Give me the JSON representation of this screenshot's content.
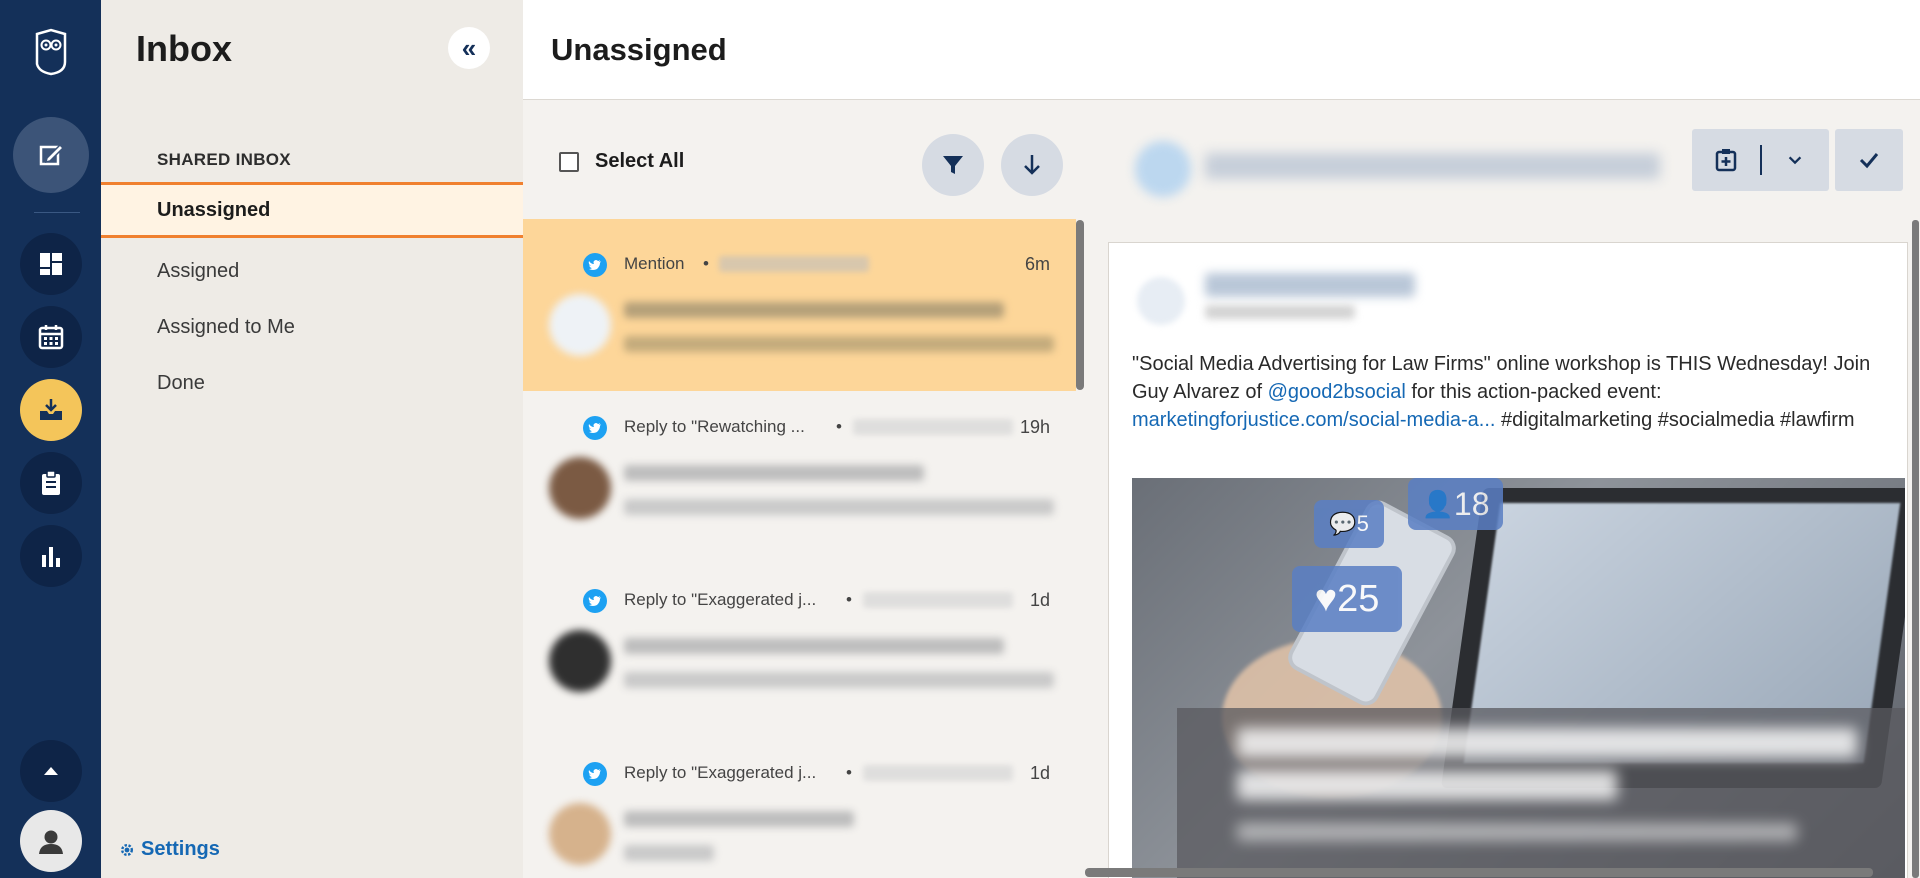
{
  "app": {
    "brand_icon": "owl-logo-icon"
  },
  "rail": {
    "items": [
      {
        "name": "compose",
        "icon": "compose-icon"
      },
      {
        "name": "dashboard",
        "icon": "dashboard-grid-icon"
      },
      {
        "name": "planner",
        "icon": "calendar-icon"
      },
      {
        "name": "inbox",
        "icon": "inbox-icon",
        "active": true
      },
      {
        "name": "assignments",
        "icon": "clipboard-icon"
      },
      {
        "name": "analytics",
        "icon": "bar-chart-icon"
      },
      {
        "name": "expand",
        "icon": "chevron-up-icon"
      },
      {
        "name": "profile",
        "icon": "user-avatar-icon"
      }
    ],
    "accent": "#f4c55a"
  },
  "nav": {
    "title": "Inbox",
    "section_label": "SHARED INBOX",
    "items": [
      {
        "label": "Unassigned",
        "active": true
      },
      {
        "label": "Assigned"
      },
      {
        "label": "Assigned to Me"
      },
      {
        "label": "Done"
      }
    ],
    "settings_label": "Settings"
  },
  "header": {
    "title": "Unassigned"
  },
  "list": {
    "select_all_label": "Select All",
    "messages": [
      {
        "type": "Mention",
        "time": "6m",
        "active": true
      },
      {
        "type": "Reply to \"Rewatching ...",
        "time": "19h"
      },
      {
        "type": "Reply to \"Exaggerated j...",
        "time": "1d"
      },
      {
        "type": "Reply to \"Exaggerated j...",
        "time": "1d"
      }
    ]
  },
  "detail": {
    "post": {
      "text_1": "\"Social Media Advertising for Law Firms\" online workshop is THIS Wednesday! Join Guy Alvarez of ",
      "mention": "@good2bsocial",
      "text_2": " for this action-packed event: ",
      "link": "marketingforjustice.com/social-media-a...",
      "text_3": " #digitalmarketing #socialmedia #lawfirm",
      "image_badges": {
        "comments": "5",
        "followers": "18",
        "likes": "25"
      }
    }
  },
  "colors": {
    "rail_bg": "#143059",
    "nav_active_border": "#f0802f",
    "active_message_bg": "#fdd699",
    "link": "#1568b4"
  }
}
